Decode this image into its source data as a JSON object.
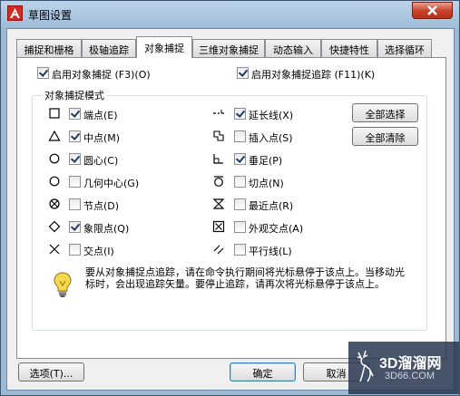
{
  "window": {
    "title": "草图设置",
    "accent": "#d42a1f"
  },
  "tabs": [
    {
      "label": "捕捉和栅格",
      "active": false
    },
    {
      "label": "极轴追踪",
      "active": false
    },
    {
      "label": "对象捕捉",
      "active": true
    },
    {
      "label": "三维对象捕捉",
      "active": false
    },
    {
      "label": "动态输入",
      "active": false
    },
    {
      "label": "快捷特性",
      "active": false
    },
    {
      "label": "选择循环",
      "active": false
    }
  ],
  "top_options": {
    "enable_osnap": {
      "label": "启用对象捕捉 (F3)(O)",
      "checked": true
    },
    "enable_tracking": {
      "label": "启用对象捕捉追踪 (F11)(K)",
      "checked": true
    }
  },
  "modes_group": {
    "title": "对象捕捉模式",
    "left": [
      {
        "icon": "square-icon",
        "label": "端点(E)",
        "checked": true
      },
      {
        "icon": "triangle-icon",
        "label": "中点(M)",
        "checked": true
      },
      {
        "icon": "circle-icon",
        "label": "圆心(C)",
        "checked": true
      },
      {
        "icon": "circle-icon",
        "label": "几何中心(G)",
        "checked": false
      },
      {
        "icon": "node-icon",
        "label": "节点(D)",
        "checked": false
      },
      {
        "icon": "diamond-icon",
        "label": "象限点(Q)",
        "checked": true
      },
      {
        "icon": "cross-icon",
        "label": "交点(I)",
        "checked": false
      }
    ],
    "right": [
      {
        "icon": "extension-icon",
        "label": "延长线(X)",
        "checked": true
      },
      {
        "icon": "insertion-icon",
        "label": "插入点(S)",
        "checked": false
      },
      {
        "icon": "perpendicular-icon",
        "label": "垂足(P)",
        "checked": true
      },
      {
        "icon": "tangent-icon",
        "label": "切点(N)",
        "checked": false
      },
      {
        "icon": "nearest-icon",
        "label": "最近点(R)",
        "checked": false
      },
      {
        "icon": "apparent-intersection-icon",
        "label": "外观交点(A)",
        "checked": false
      },
      {
        "icon": "parallel-icon",
        "label": "平行线(L)",
        "checked": false
      }
    ],
    "select_all": "全部选择",
    "clear_all": "全部清除"
  },
  "info": {
    "icon": "lightbulb-icon",
    "text": "要从对象捕捉点追踪，请在命令执行期间将光标悬停于该点上。当移动光标时，会出现追踪矢量。要停止追踪，请再次将光标悬停于该点上。"
  },
  "footer": {
    "options": "选项(T)...",
    "ok": "确定",
    "cancel": "取消"
  },
  "watermark": {
    "text": "3D溜溜网",
    "sub": "3D66.COM"
  }
}
